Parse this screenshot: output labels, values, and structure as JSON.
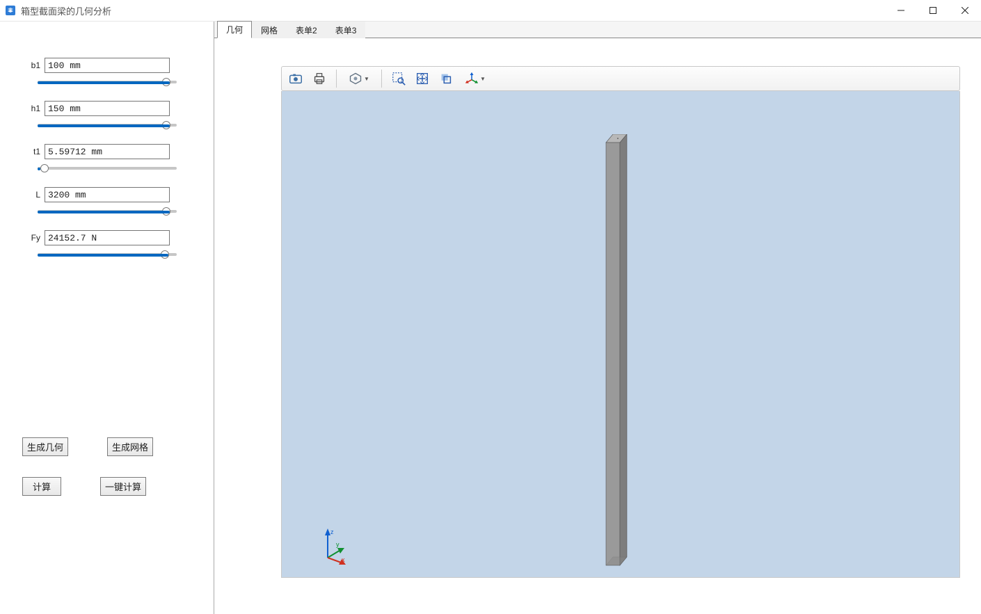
{
  "window": {
    "title": "箱型截面梁的几何分析"
  },
  "sidebar": {
    "fields": [
      {
        "label": "b1",
        "value": "100 mm",
        "slider_pct": 95
      },
      {
        "label": "h1",
        "value": "150 mm",
        "slider_pct": 95
      },
      {
        "label": "t1",
        "value": "5.59712 mm",
        "slider_pct": 2
      },
      {
        "label": "L",
        "value": "3200 mm",
        "slider_pct": 95
      },
      {
        "label": "Fy",
        "value": "24152.7 N",
        "slider_pct": 94
      }
    ],
    "buttons": {
      "gen_geometry": "生成几何",
      "gen_mesh": "生成网格",
      "compute": "计算",
      "one_click": "一键计算"
    }
  },
  "tabs": [
    {
      "label": "几何",
      "active": true
    },
    {
      "label": "网格",
      "active": false
    },
    {
      "label": "表单2",
      "active": false
    },
    {
      "label": "表单3",
      "active": false
    }
  ],
  "toolbar": {
    "camera": "camera-icon",
    "print": "print-icon",
    "render": "render-mode-icon",
    "zoom_box": "zoom-box-icon",
    "zoom_extents": "zoom-extents-icon",
    "transparent": "transparency-icon",
    "axes": "axes-toggle-icon"
  },
  "triad": {
    "x": "x",
    "y": "y",
    "z": "z"
  }
}
